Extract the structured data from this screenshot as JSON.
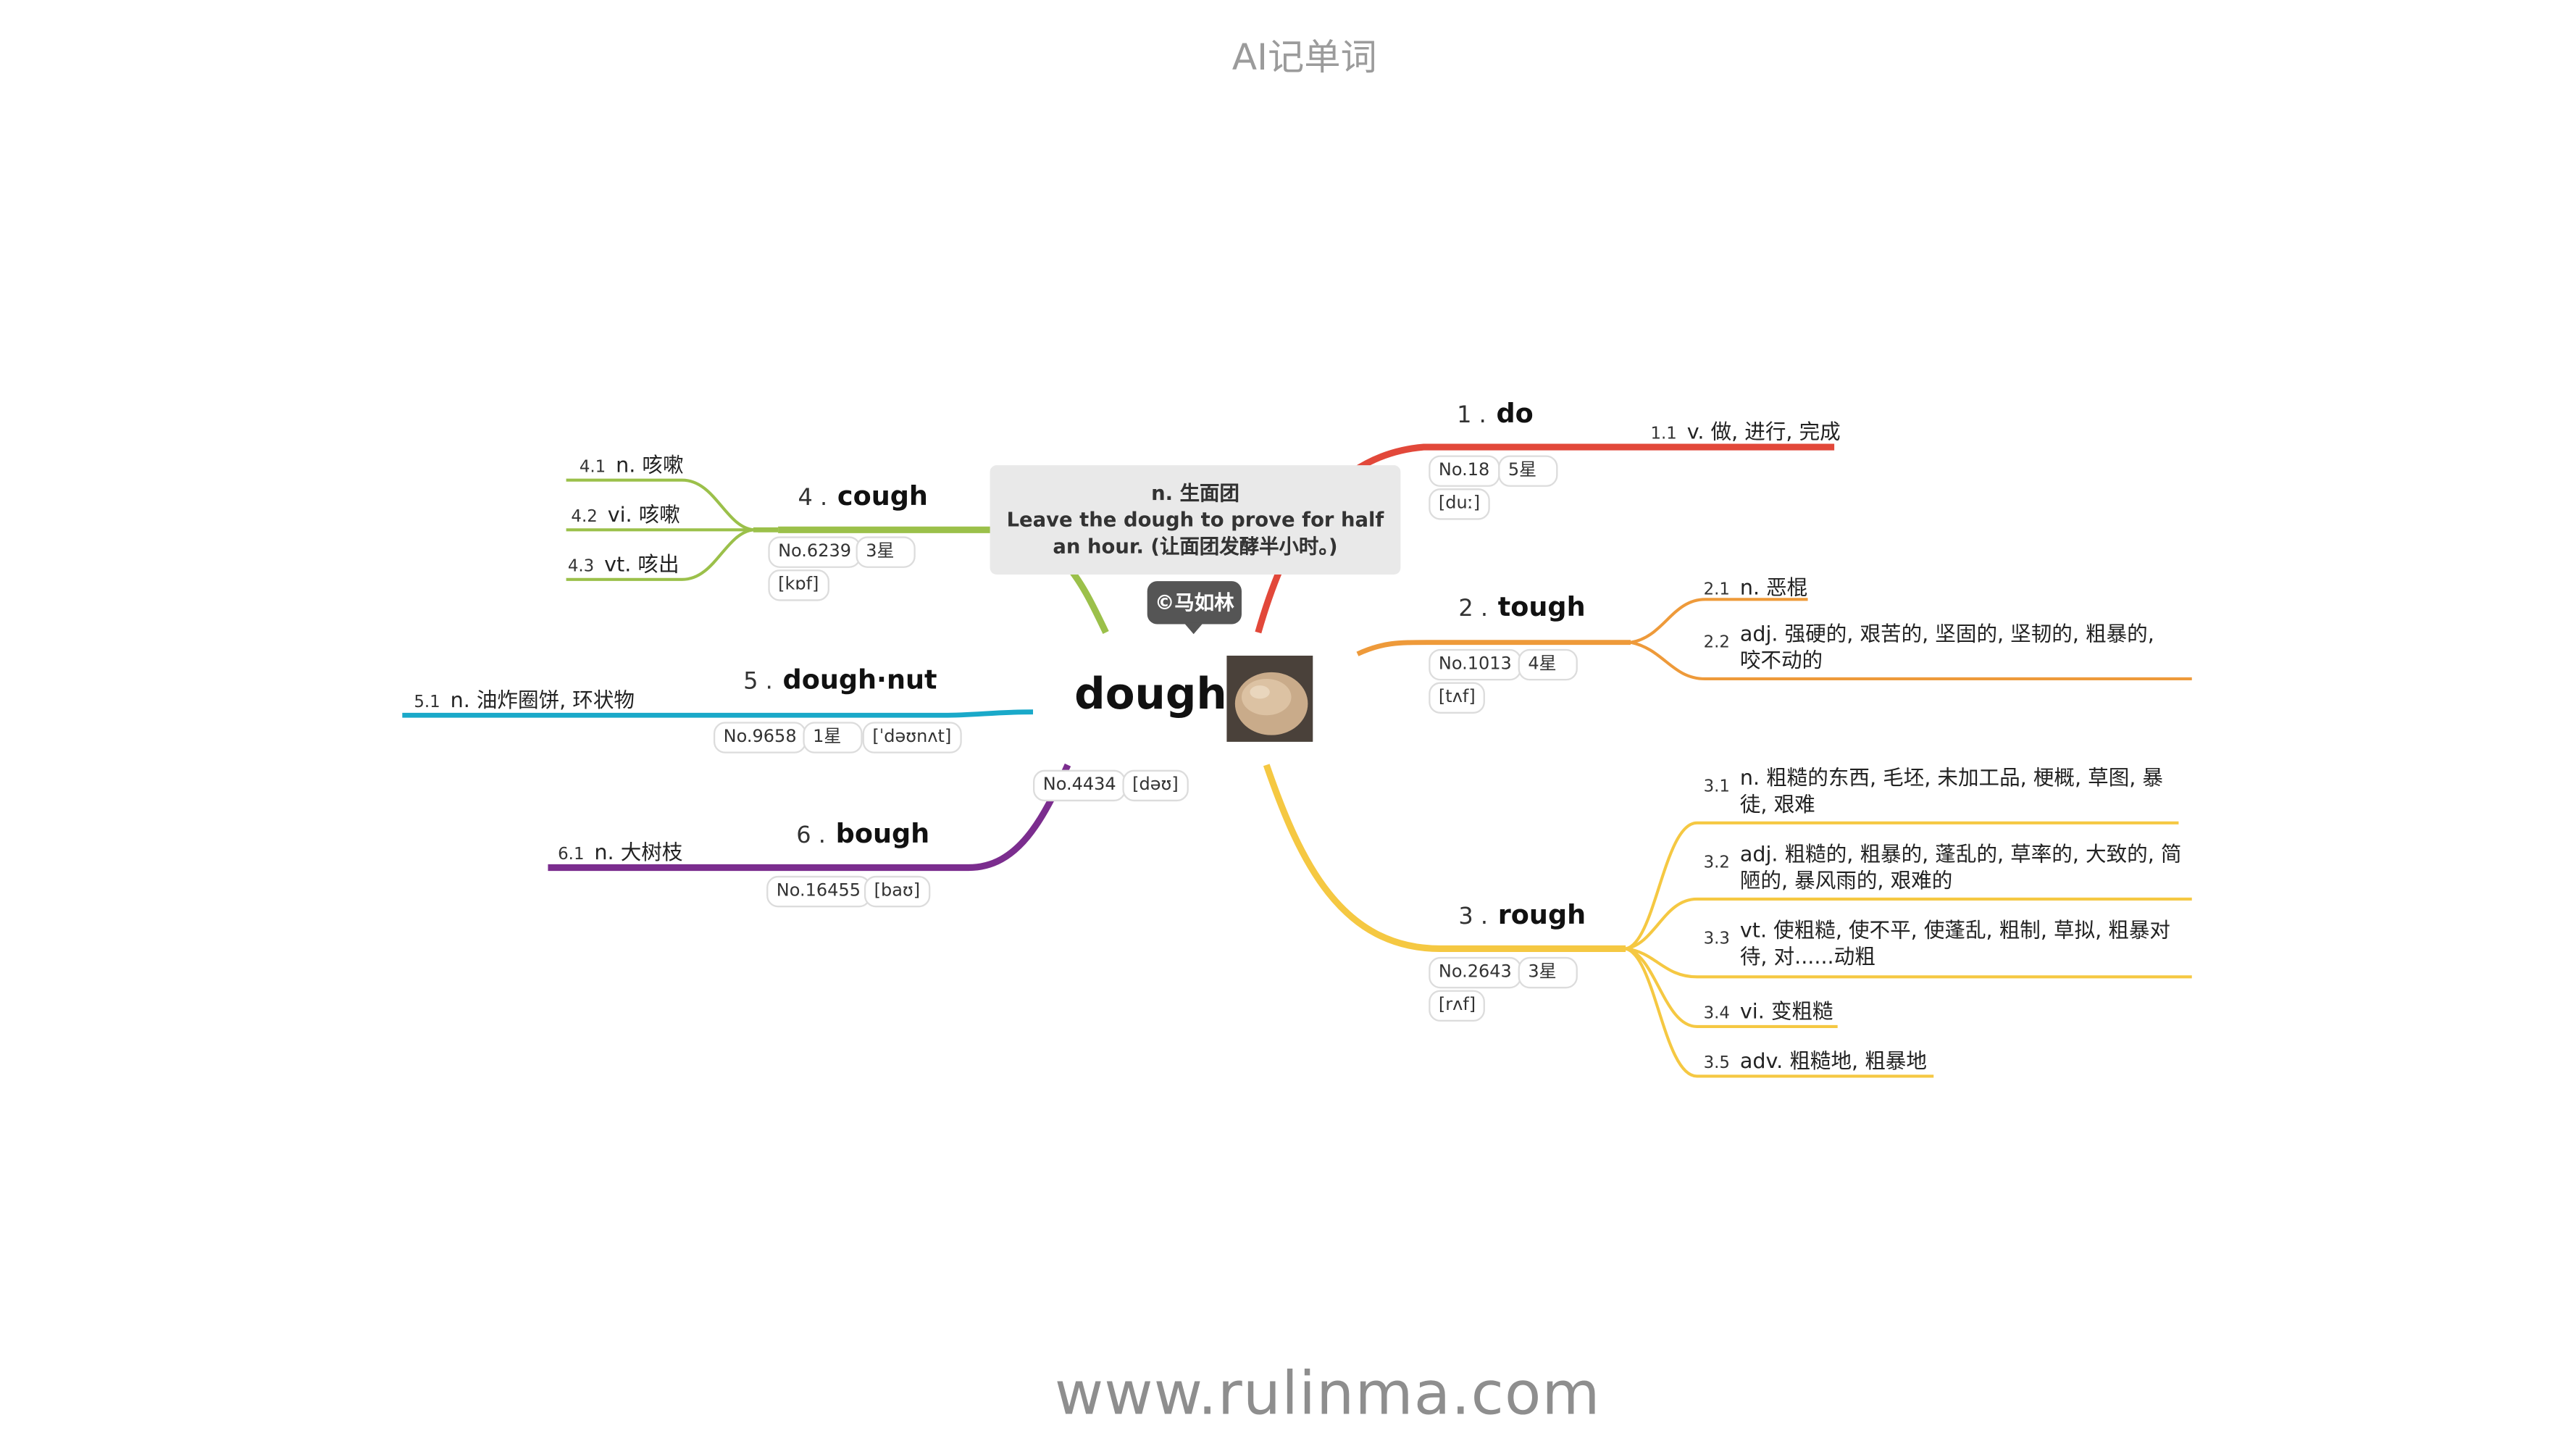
{
  "header": {
    "title": "AI记单词"
  },
  "footer": {
    "url": "www.rulinma.com"
  },
  "center": {
    "word": "dough",
    "no": "No.4434",
    "phonetic": "[dəʊ]",
    "note_line1": "n. 生面团",
    "note_line2": "Leave the dough to prove for half an hour. (让面团发酵半小时。)",
    "author": "©马如林"
  },
  "colors": {
    "do": "#e2483a",
    "tough": "#ee9a3a",
    "rough": "#f5c842",
    "cough": "#9bc04a",
    "doughnut": "#1aa9c9",
    "bough": "#7b2d8e"
  },
  "branches": {
    "do": {
      "num": "1 .",
      "word": "do",
      "no": "No.18",
      "stars": "5星",
      "phonetic": "[duː]",
      "senses": [
        {
          "num": "1.1",
          "text": "v. 做, 进行, 完成"
        }
      ]
    },
    "tough": {
      "num": "2 .",
      "word": "tough",
      "no": "No.1013",
      "stars": "4星",
      "phonetic": "[tʌf]",
      "senses": [
        {
          "num": "2.1",
          "text": "n. 恶棍"
        },
        {
          "num": "2.2",
          "text": "adj. 强硬的, 艰苦的, 坚固的, 坚韧的, 粗暴的, 咬不动的"
        }
      ]
    },
    "rough": {
      "num": "3 .",
      "word": "rough",
      "no": "No.2643",
      "stars": "3星",
      "phonetic": "[rʌf]",
      "senses": [
        {
          "num": "3.1",
          "text": "n. 粗糙的东西, 毛坯, 未加工品, 梗概, 草图, 暴徒, 艰难"
        },
        {
          "num": "3.2",
          "text": "adj. 粗糙的, 粗暴的, 蓬乱的, 草率的, 大致的, 简陋的, 暴风雨的, 艰难的"
        },
        {
          "num": "3.3",
          "text": "vt. 使粗糙, 使不平, 使蓬乱, 粗制, 草拟, 粗暴对待, 对......动粗"
        },
        {
          "num": "3.4",
          "text": "vi. 变粗糙"
        },
        {
          "num": "3.5",
          "text": "adv. 粗糙地, 粗暴地"
        }
      ]
    },
    "cough": {
      "num": "4 .",
      "word": "cough",
      "no": "No.6239",
      "stars": "3星",
      "phonetic": "[kɒf]",
      "senses": [
        {
          "num": "4.1",
          "text": "n. 咳嗽"
        },
        {
          "num": "4.2",
          "text": "vi. 咳嗽"
        },
        {
          "num": "4.3",
          "text": "vt. 咳出"
        }
      ]
    },
    "doughnut": {
      "num": "5 .",
      "word": "dough·nut",
      "no": "No.9658",
      "stars": "1星",
      "phonetic": "[ˈdəʊnʌt]",
      "senses": [
        {
          "num": "5.1",
          "text": "n. 油炸圈饼, 环状物"
        }
      ]
    },
    "bough": {
      "num": "6 .",
      "word": "bough",
      "no": "No.16455",
      "phonetic": "[baʊ]",
      "senses": [
        {
          "num": "6.1",
          "text": "n. 大树枝"
        }
      ]
    }
  }
}
